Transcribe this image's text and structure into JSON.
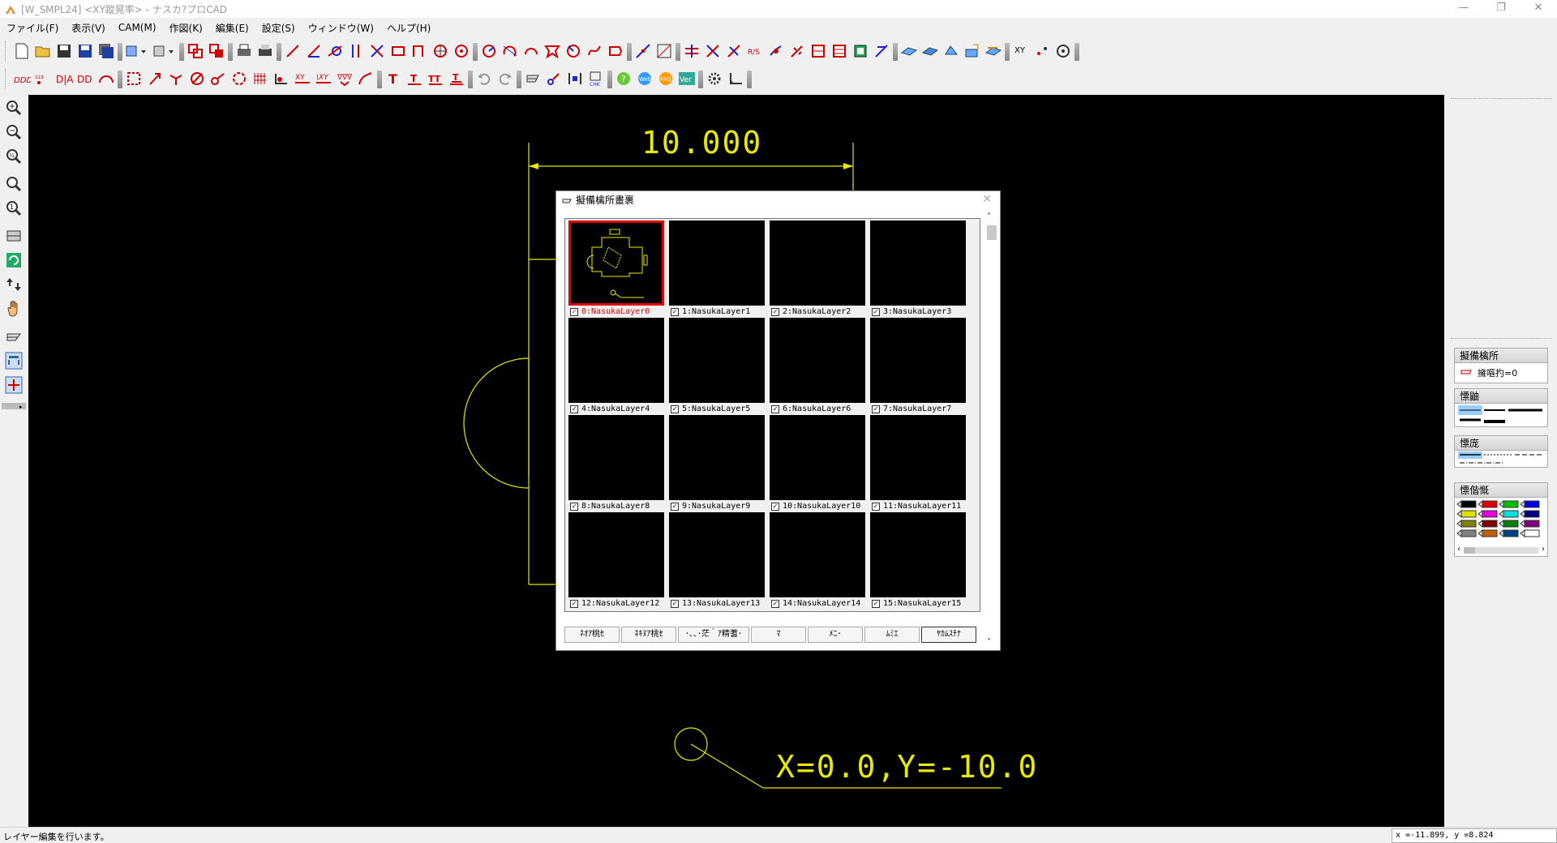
{
  "window": {
    "title": "[W_SMPL24] <XY蹤晃率> - ナスカ?プロCAD",
    "controls": [
      "—",
      "❐",
      "✕"
    ]
  },
  "menubar": [
    "ファイル(F)",
    "表示(V)",
    "CAM(M)",
    "作図(K)",
    "編集(E)",
    "設定(S)",
    "ウィンドウ(W)",
    "ヘルプ(H)"
  ],
  "toolbar_row1_icons": [
    "new-file-icon",
    "open-folder-icon",
    "save-icon",
    "save-as-icon",
    "save-all-icon",
    "import-icon",
    "export-icon",
    "copy-layer-icon",
    "paste-layer-icon",
    "print-icon",
    "printer-setup-icon",
    "line-icon",
    "angle-line-icon",
    "tangent-line-icon",
    "parallel-line-icon",
    "perpendicular-icon",
    "rectangle-icon",
    "polyline-icon",
    "circle-center-icon",
    "circle-icon",
    "arc-icon",
    "fillet-icon",
    "arc-3pt-icon",
    "polygon-icon",
    "spline-icon",
    "chamfer-icon",
    "dimension-line-icon",
    "frame-icon",
    "trim-icon",
    "cross-icon",
    "break-icon",
    "scale-icon",
    "mirror-icon",
    "point-icon",
    "hole-icon",
    "offset-icon",
    "array-icon",
    "measure-icon",
    "plane-view-icon",
    "iso-view-icon",
    "solid-icon",
    "surface-icon",
    "edge-icon",
    "xy-coord-icon",
    "dot-icon",
    "target-icon"
  ],
  "toolbar_row2_icons": [
    "dim-horizontal-icon",
    "dim-vertical-icon",
    "dim-diagonal-icon",
    "dim-diameter-icon",
    "dim-angle-icon",
    "region-icon",
    "corner-icon",
    "join-icon",
    "no-circle-icon",
    "link-icon",
    "rotate-icon",
    "grid-icon",
    "node-icon",
    "xy-dim-icon",
    "xy-align-icon",
    "chevron-dim-icon",
    "curve-arrow-icon",
    "text-icon",
    "text-underline-icon",
    "text-base-icon",
    "text-fill-icon",
    "undo-icon",
    "redo-icon",
    "layer-icon",
    "cam-path-icon",
    "width-icon",
    "check-icon",
    "help-icon",
    "web-icon",
    "faq-icon",
    "version-icon",
    "gear-icon",
    "corner-tool-icon"
  ],
  "left_toolbar_icons": [
    "zoom-in-icon",
    "zoom-out-icon",
    "zoom-half-icon",
    "zoom-window-icon",
    "zoom-one-icon",
    "fit-icon",
    "redraw-icon",
    "swap-icon",
    "pan-hand-icon",
    "layer-stack-icon",
    "frame-view-icon",
    "crosshair-icon"
  ],
  "canvas": {
    "dimension_text": "10.000",
    "coord_annotation": "X=0.0,Y=-10.0",
    "line_color": "#e8e800",
    "background": "#000000"
  },
  "dialog": {
    "title": "擬備檎所畫裹",
    "layers": [
      {
        "label": "0:NasukaLayer0",
        "checked": true,
        "active": true
      },
      {
        "label": "1:NasukaLayer1",
        "checked": true,
        "active": false
      },
      {
        "label": "2:NasukaLayer2",
        "checked": true,
        "active": false
      },
      {
        "label": "3:NasukaLayer3",
        "checked": true,
        "active": false
      },
      {
        "label": "4:NasukaLayer4",
        "checked": true,
        "active": false
      },
      {
        "label": "5:NasukaLayer5",
        "checked": true,
        "active": false
      },
      {
        "label": "6:NasukaLayer6",
        "checked": true,
        "active": false
      },
      {
        "label": "7:NasukaLayer7",
        "checked": true,
        "active": false
      },
      {
        "label": "8:NasukaLayer8",
        "checked": true,
        "active": false
      },
      {
        "label": "9:NasukaLayer9",
        "checked": true,
        "active": false
      },
      {
        "label": "10:NasukaLayer10",
        "checked": true,
        "active": false
      },
      {
        "label": "11:NasukaLayer11",
        "checked": true,
        "active": false
      },
      {
        "label": "12:NasukaLayer12",
        "checked": true,
        "active": false
      },
      {
        "label": "13:NasukaLayer13",
        "checked": true,
        "active": false
      },
      {
        "label": "14:NasukaLayer14",
        "checked": true,
        "active": false
      },
      {
        "label": "15:NasukaLayer15",
        "checked": true,
        "active": false
      }
    ],
    "buttons": [
      "ﾈｵｱ桃ｾ",
      "ﾈｷﾇｱ桃ｾ",
      "･､､･茫｀ｱ精蓍･",
      "ﾏ",
      "ﾒﾆ･",
      "ﾑﾐｴ",
      "ﾔｶﾑｽﾁﾅ"
    ]
  },
  "right_panel": {
    "groups": [
      {
        "title": "擬備檎所",
        "value": "擁嘔扚=0"
      },
      {
        "title": "慓鼬",
        "value": ""
      },
      {
        "title": "慓庞",
        "value": ""
      },
      {
        "title": "慓偕慨",
        "value": ""
      }
    ],
    "palette_colors": [
      "#000000",
      "#e00000",
      "#00c000",
      "#0000e0",
      "#e0e000",
      "#e000e0",
      "#00e0e0",
      "#000080",
      "#808000",
      "#800000",
      "#008000",
      "#800080",
      "#808080",
      "#c06000",
      "#004080",
      "#ffffff"
    ]
  },
  "statusbar": {
    "message": "レイヤー編集を行います。",
    "coordinates": "x =-11.899,     y =8.824"
  }
}
